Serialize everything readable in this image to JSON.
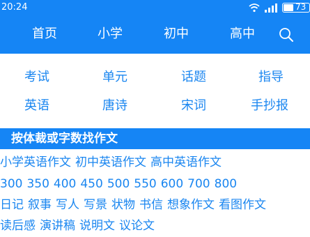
{
  "status_bar": {
    "time": "20:24",
    "battery_text": "73",
    "wifi_icon": "wifi-icon",
    "signal_icon": "signal-icon",
    "battery_icon": "battery-icon"
  },
  "nav": {
    "items": [
      {
        "label": "首页"
      },
      {
        "label": "小学"
      },
      {
        "label": "初中"
      },
      {
        "label": "高中"
      }
    ],
    "search_icon": "search-icon"
  },
  "categories": {
    "row1": [
      {
        "label": "考试"
      },
      {
        "label": "单元"
      },
      {
        "label": "话题"
      },
      {
        "label": "指导"
      }
    ],
    "row2": [
      {
        "label": "英语"
      },
      {
        "label": "唐诗"
      },
      {
        "label": "宋词"
      },
      {
        "label": "手抄报"
      }
    ]
  },
  "section": {
    "title": "按体裁或字数找作文"
  },
  "links": {
    "english": [
      "小学英语作文",
      "初中英语作文",
      "高中英语作文"
    ],
    "word_counts": [
      "300",
      "350",
      "400",
      "450",
      "500",
      "550",
      "600",
      "700",
      "800"
    ],
    "genres_1": [
      "日记",
      "叙事",
      "写人",
      "写景",
      "状物",
      "书信",
      "想象作文",
      "看图作文"
    ],
    "genres_2": [
      "读后感",
      "演讲稿",
      "说明文",
      "议论文"
    ]
  },
  "colors": {
    "brand_blue": "#1585f5",
    "link_blue": "#1a86f0",
    "background": "#ffffff"
  }
}
